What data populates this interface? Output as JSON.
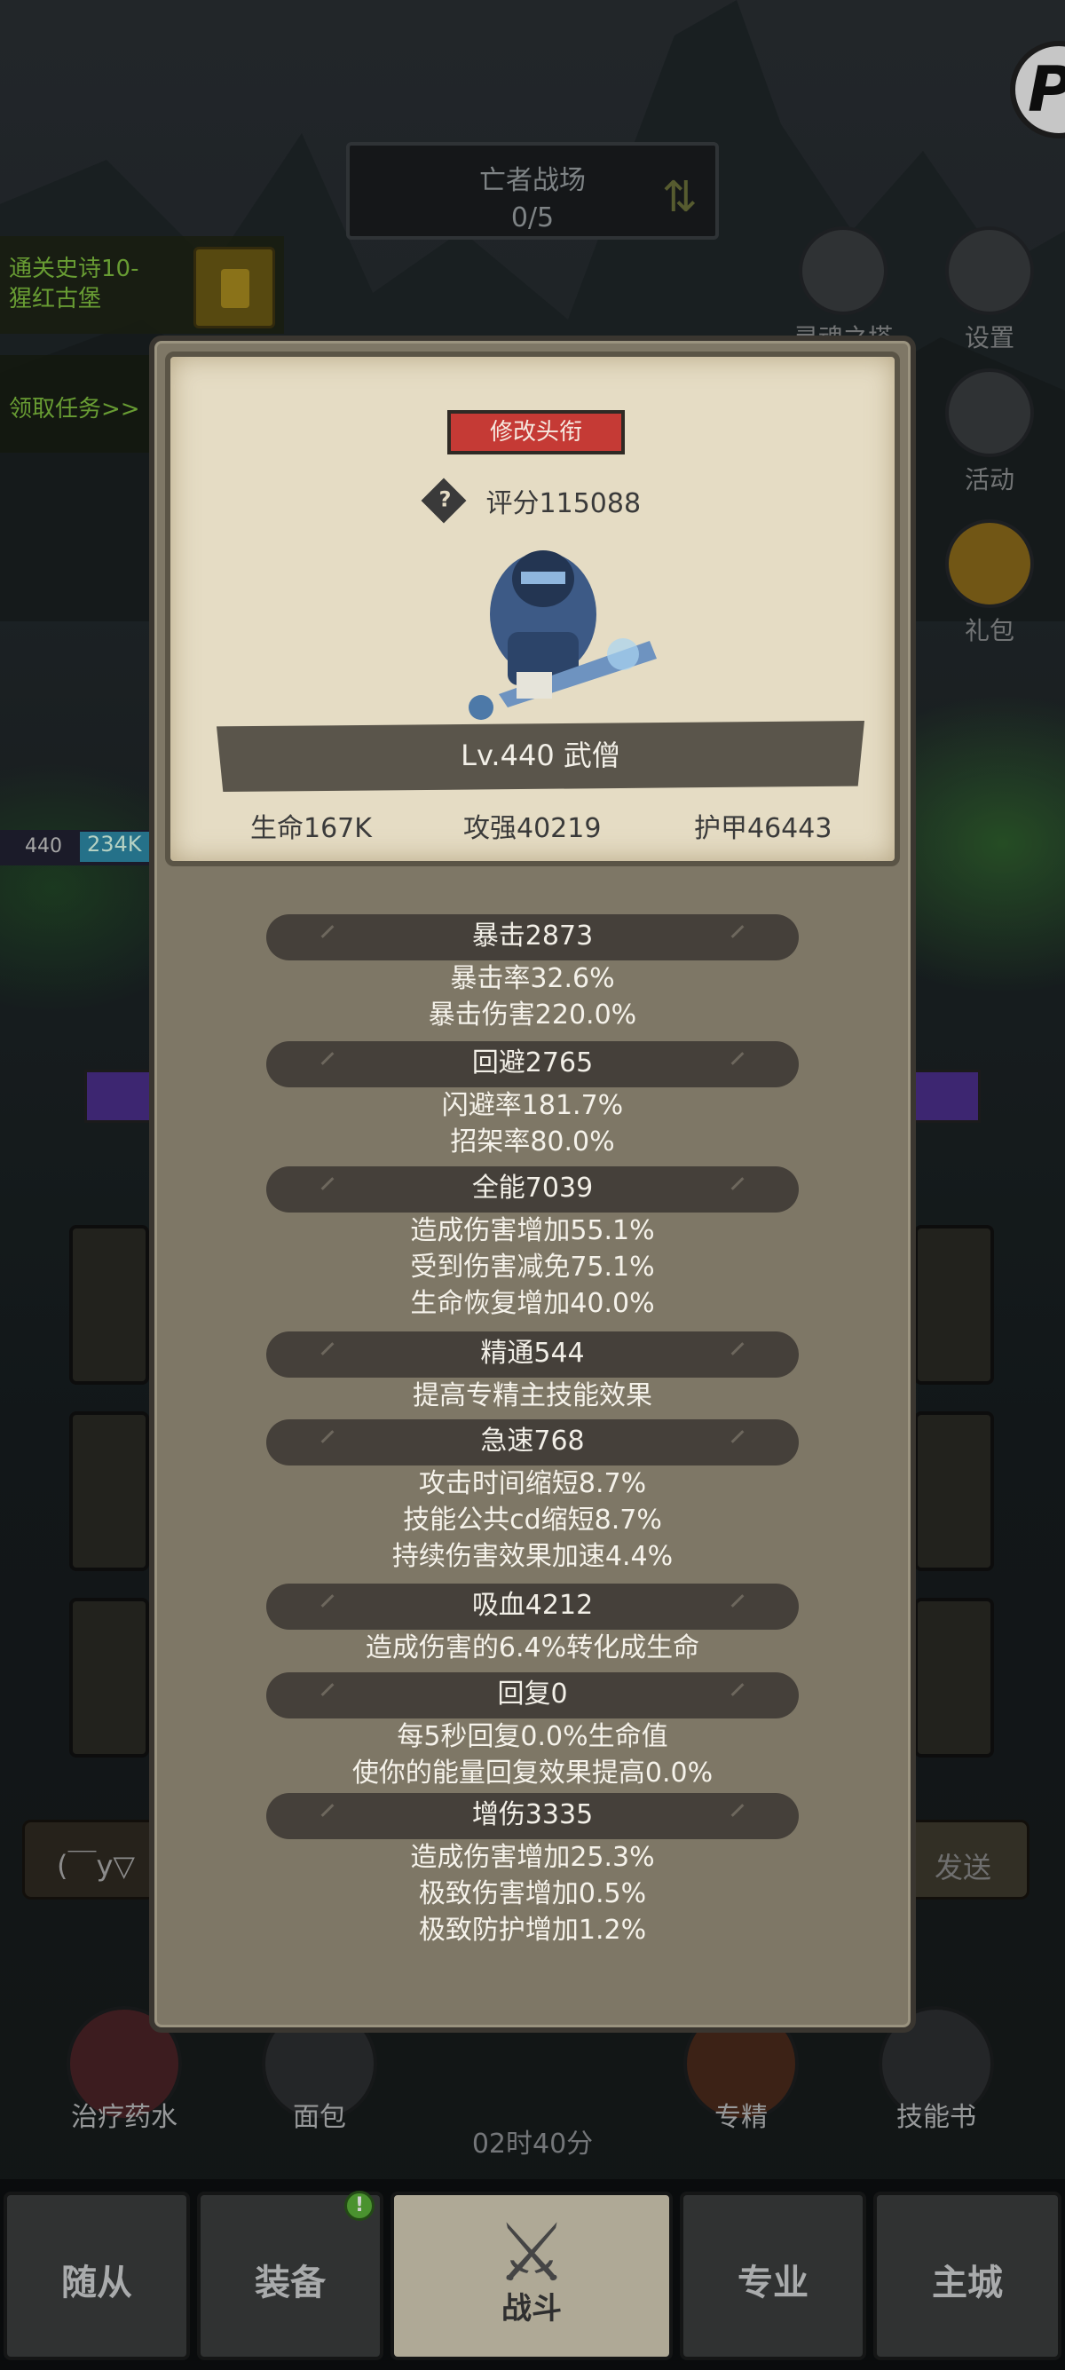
{
  "background": {
    "battlefield_title": "亡者战场",
    "battlefield_progress": "0/5",
    "quest_text_line1": "通关史诗10-",
    "quest_text_line2": "猩红古堡",
    "take_task": "领取任务>>",
    "side_buttons": [
      "灵魂之塔",
      "设置",
      "活动",
      "礼包"
    ],
    "hero_level": "440",
    "hero_hp": "234K",
    "chat_placeholder": "(￣y▽",
    "send": "发送",
    "consumables": [
      "治疗药水",
      "面包",
      "专精",
      "技能书"
    ],
    "timer": "02时40分"
  },
  "nav": {
    "tabs": [
      "随从",
      "装备",
      "战斗",
      "专业",
      "主城"
    ],
    "active": "战斗",
    "badge": "!"
  },
  "modal": {
    "edit_title_button": "修改头衔",
    "help_icon": "?",
    "score": "评分115088",
    "name": "Lv.440 武僧",
    "stats": {
      "hp": "生命167K",
      "attack": "攻强40219",
      "armor": "护甲46443"
    },
    "attributes": [
      {
        "name": "暴击2873",
        "lines": [
          "暴击率32.6%",
          "暴击伤害220.0%"
        ]
      },
      {
        "name": "回避2765",
        "lines": [
          "闪避率181.7%",
          "招架率80.0%"
        ]
      },
      {
        "name": "全能7039",
        "lines": [
          "造成伤害增加55.1%",
          "受到伤害减免75.1%",
          "生命恢复增加40.0%"
        ]
      },
      {
        "name": "精通544",
        "lines": [
          "提高专精主技能效果"
        ]
      },
      {
        "name": "急速768",
        "lines": [
          "攻击时间缩短8.7%",
          "技能公共cd缩短8.7%",
          "持续伤害效果加速4.4%"
        ]
      },
      {
        "name": "吸血4212",
        "lines": [
          "造成伤害的6.4%转化成生命"
        ]
      },
      {
        "name": "回复0",
        "lines": [
          "每5秒回复0.0%生命值",
          "使你的能量回复效果提高0.0%"
        ]
      },
      {
        "name": "增伤3335",
        "lines": [
          "造成伤害增加25.3%",
          "极致伤害增加0.5%",
          "极致防护增加1.2%"
        ]
      }
    ]
  },
  "colors": {
    "modal_bg": "#7e7766",
    "parchment": "#e5dcc4",
    "pill": "#45403a",
    "edit_button": "#c53a35",
    "quest_text": "#7fbf3f"
  }
}
